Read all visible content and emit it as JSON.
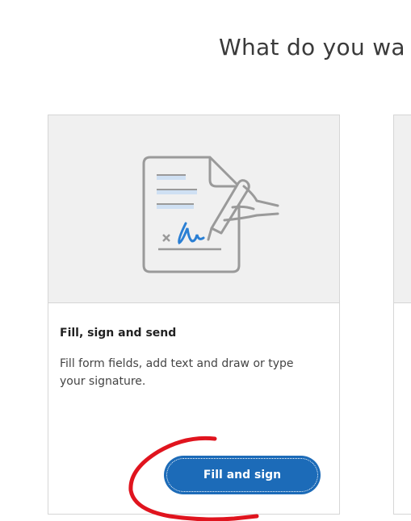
{
  "page": {
    "heading": "What do you wa"
  },
  "card": {
    "title": "Fill, sign and send",
    "description": "Fill form fields, add text and draw or type your signature.",
    "button_label": "Fill and sign",
    "illustration_icon": "document-signature-icon"
  },
  "colors": {
    "button": "#1c6bb8",
    "illustration_bg": "#f0f0f0",
    "annotation": "#e0141e",
    "signature": "#2a7fd4"
  }
}
